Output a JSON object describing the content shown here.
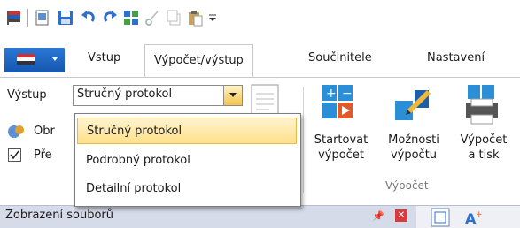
{
  "tabs": {
    "vstup": "Vstup",
    "vypocet": "Výpočet/výstup",
    "soucinitele": "Součinitele",
    "nastaveni": "Nastavení"
  },
  "output": {
    "label": "Výstup",
    "selected": "Stručný protokol",
    "options": [
      "Stručný protokol",
      "Podrobný protokol",
      "Detailní protokol"
    ],
    "check1_partial": "Obr",
    "check2_partial": "Pře"
  },
  "buttons": {
    "start_line1": "Startovat",
    "start_line2": "výpočet",
    "options_line1": "Možnosti",
    "options_line2": "výpočtu",
    "print_line1": "Výpočet",
    "print_line2": "a tisk"
  },
  "group_label": "Výpočet",
  "pane": {
    "title": "Zobrazení souborů",
    "pin": "ꟷ",
    "close": "x"
  },
  "colors": {
    "accent": "#1e6fd1",
    "highlight": "#ffe08a",
    "pane_bg": "#d6dbe9"
  }
}
